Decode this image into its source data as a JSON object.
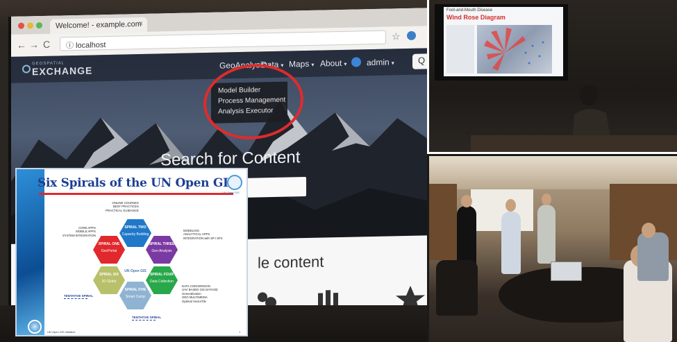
{
  "browser": {
    "tab_title": "Welcome! - example.com",
    "tab_close": "×",
    "url": "ⓘ localhost",
    "nav_back": "←",
    "nav_forward": "→",
    "nav_reload": "C",
    "bookmark_star": "☆"
  },
  "site": {
    "logo_small": "GEOSPATIAL",
    "logo_big": "EXCHANGE",
    "menu": [
      "GeoAnalysis",
      "Data",
      "Maps",
      "About"
    ],
    "user": "admin",
    "search_icon": "Q",
    "dropdown": [
      "Model Builder",
      "Process Management",
      "Analysis Executor"
    ],
    "headline": "Search for Content",
    "sub_headline": "le content"
  },
  "slide": {
    "title": "Six Spirals of the UN Open GIS",
    "un_label": "UN Open GIS",
    "center_label": "UN Open GIS",
    "hexes": [
      {
        "label": "SPIRAL TWO",
        "sub": "Capacity Building",
        "color": "#1f78c8"
      },
      {
        "label": "SPIRAL ONE",
        "sub": "GeoPortal",
        "color": "#e0282d"
      },
      {
        "label": "SPIRAL THREE",
        "sub": "Geo Analysis",
        "color": "#7b3aa3"
      },
      {
        "label": "SPIRAL SIX",
        "sub": "2D Globe",
        "color": "#b8c06a"
      },
      {
        "label": "SPIRAL FOUR",
        "sub": "Data Collection",
        "color": "#28a84a"
      },
      {
        "label": "SPIRAL FIVE",
        "sub": "Smart Camp",
        "color": "#8fb3d2"
      }
    ],
    "notes": {
      "top": [
        "ONLINE COURSES",
        "BEST PRACTICES",
        "PRACTICAL GUIDANCE"
      ],
      "left": [
        "CORE APPS",
        "MOBILE APPS",
        "SYSTEM INTEGRATION"
      ],
      "right": [
        "MODELING",
        "ANALYTICAL APPS",
        "INTEGRATION with SP I SP4"
      ],
      "bottom_right": [
        "DATA CONVERSION",
        "UAV BASED GIS DATA/3D",
        "Generalization",
        "GEO MULTIMEDIA",
        "Optimal VectorTile"
      ]
    },
    "tentative_left": "TENTATIVE SPIRAL",
    "tentative_bottom": "TENTATIVE SPIRAL",
    "footer": "UN Open GIS Initiative",
    "page": "1"
  },
  "tv": {
    "header": "Foot-and-Mouth Disease",
    "title": "Wind Rose Diagram"
  },
  "colors": {
    "highlight_ring": "#e02b2b",
    "slide_title": "#1d3f93",
    "title_underline": "#e0282d",
    "tv_title": "#d42b2b"
  }
}
